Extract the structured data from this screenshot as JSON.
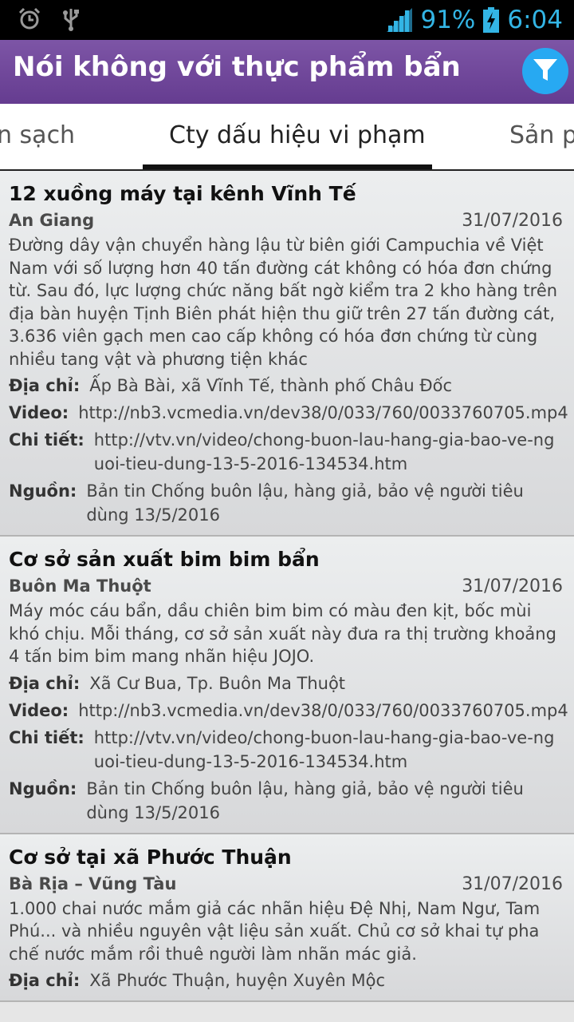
{
  "status_bar": {
    "left_icons": [
      "alarm-icon",
      "usb-icon"
    ],
    "battery": "91%",
    "time": "6:04"
  },
  "app_bar": {
    "title": "Nói không với thực phẩm bẩn",
    "filter_icon": "filter-icon",
    "accent_color": "#27a9f2",
    "bar_color": "#6f479a"
  },
  "tabs": [
    "n sạch",
    "Cty dấu hiệu vi phạm",
    "Sản p"
  ],
  "labels": {
    "address": "Địa chỉ:",
    "video": "Video:",
    "detail": "Chi tiết:",
    "source": "Nguồn:"
  },
  "items": [
    {
      "title": "12 xuồng máy tại kênh Vĩnh Tế",
      "location": "An Giang",
      "date": "31/07/2016",
      "description": "Đường dây vận chuyển hàng lậu từ biên giới Campuchia về Việt Nam với số lượng hơn 40 tấn đường cát không có hóa đơn chứng từ. Sau đó, lực lượng chức năng bất ngờ kiểm tra 2 kho hàng trên địa bàn huyện Tịnh Biên phát hiện thu giữ trên 27 tấn đường cát, 3.636 viên gạch men cao cấp không có hóa đơn chứng từ cùng nhiều tang vật và phương tiện khác",
      "address": "Ấp Bà Bài, xã Vĩnh Tế, thành phố Châu Đốc",
      "video": "http://nb3.vcmedia.vn/dev38/0/033/760/0033760705.mp4",
      "detail": "http://vtv.vn/video/chong-buon-lau-hang-gia-bao-ve-nguoi-tieu-dung-13-5-2016-134534.htm",
      "source": "Bản tin Chống buôn lậu, hàng giả, bảo vệ người tiêu dùng 13/5/2016"
    },
    {
      "title": "Cơ sở sản xuất bim bim bẩn",
      "location": "Buôn Ma Thuột",
      "date": "31/07/2016",
      "description": "Máy móc cáu bẩn, dầu chiên bim bim có màu đen kịt, bốc mùi khó chịu. Mỗi tháng, cơ sở sản xuất này đưa ra thị trường khoảng 4 tấn bim bim mang nhãn hiệu JOJO.",
      "address": "Xã Cư Bua, Tp. Buôn Ma Thuột",
      "video": "http://nb3.vcmedia.vn/dev38/0/033/760/0033760705.mp4",
      "detail": "http://vtv.vn/video/chong-buon-lau-hang-gia-bao-ve-nguoi-tieu-dung-13-5-2016-134534.htm",
      "source": "Bản tin Chống buôn lậu, hàng giả, bảo vệ người tiêu dùng 13/5/2016"
    },
    {
      "title": "Cơ sở tại xã Phước Thuận",
      "location": "Bà Rịa – Vũng Tàu",
      "date": "31/07/2016",
      "description": "1.000 chai nước mắm giả các nhãn hiệu Đệ Nhị, Nam Ngư, Tam Phú... và nhiều nguyên vật liệu sản xuất. Chủ cơ sở khai tự pha chế nước mắm rồi thuê người làm nhãn mác giả.",
      "address": "Xã Phước Thuận, huyện Xuyên Mộc"
    }
  ]
}
